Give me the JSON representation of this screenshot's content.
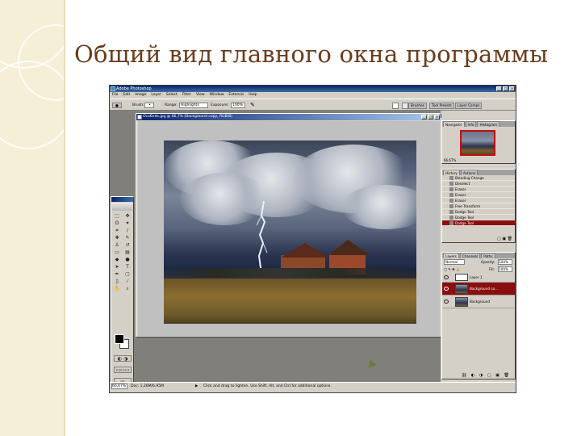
{
  "slide": {
    "title": "Общий вид главного окна программы"
  },
  "app": {
    "title": "Adobe Photoshop",
    "menus": [
      "File",
      "Edit",
      "Image",
      "Layer",
      "Select",
      "Filter",
      "View",
      "Window",
      "Extensis",
      "Help"
    ],
    "options": {
      "brush_label": "Brush:",
      "range_label": "Range:",
      "range_value": "Highlights",
      "exposure_label": "Exposure:",
      "exposure_value": "100%"
    },
    "well_tabs": [
      "Brushes",
      "Tool Presets",
      "Layer Comps"
    ],
    "document": {
      "title": "Особняк.jpg @ 66,7% (Background copy, RGB/8)"
    },
    "navigator_tabs": [
      "Navigator",
      "Info",
      "Histogram"
    ],
    "navigator_zoom": "66,67%",
    "history_tabs": [
      "History",
      "Actions"
    ],
    "history_items": [
      "Blending Change",
      "Deselect",
      "Eraser",
      "Eraser",
      "Eraser",
      "Free Transform",
      "Dodge Tool",
      "Dodge Tool",
      "Dodge Tool"
    ],
    "layers_tabs": [
      "Layers",
      "Channels",
      "Paths"
    ],
    "layers_blend": "Normal",
    "layers_opacity_label": "Opacity:",
    "layers_opacity": "100%",
    "layers_fill_label": "Fill:",
    "layers_fill": "100%",
    "layers": [
      "Layer 1",
      "Background co...",
      "Background"
    ],
    "status": {
      "zoom": "66,67%",
      "doc": "Doc: 1,26M/6,95M",
      "hint": "Click and drag to lighten. Use Shift, Alt, and Ctrl for additional options."
    }
  }
}
